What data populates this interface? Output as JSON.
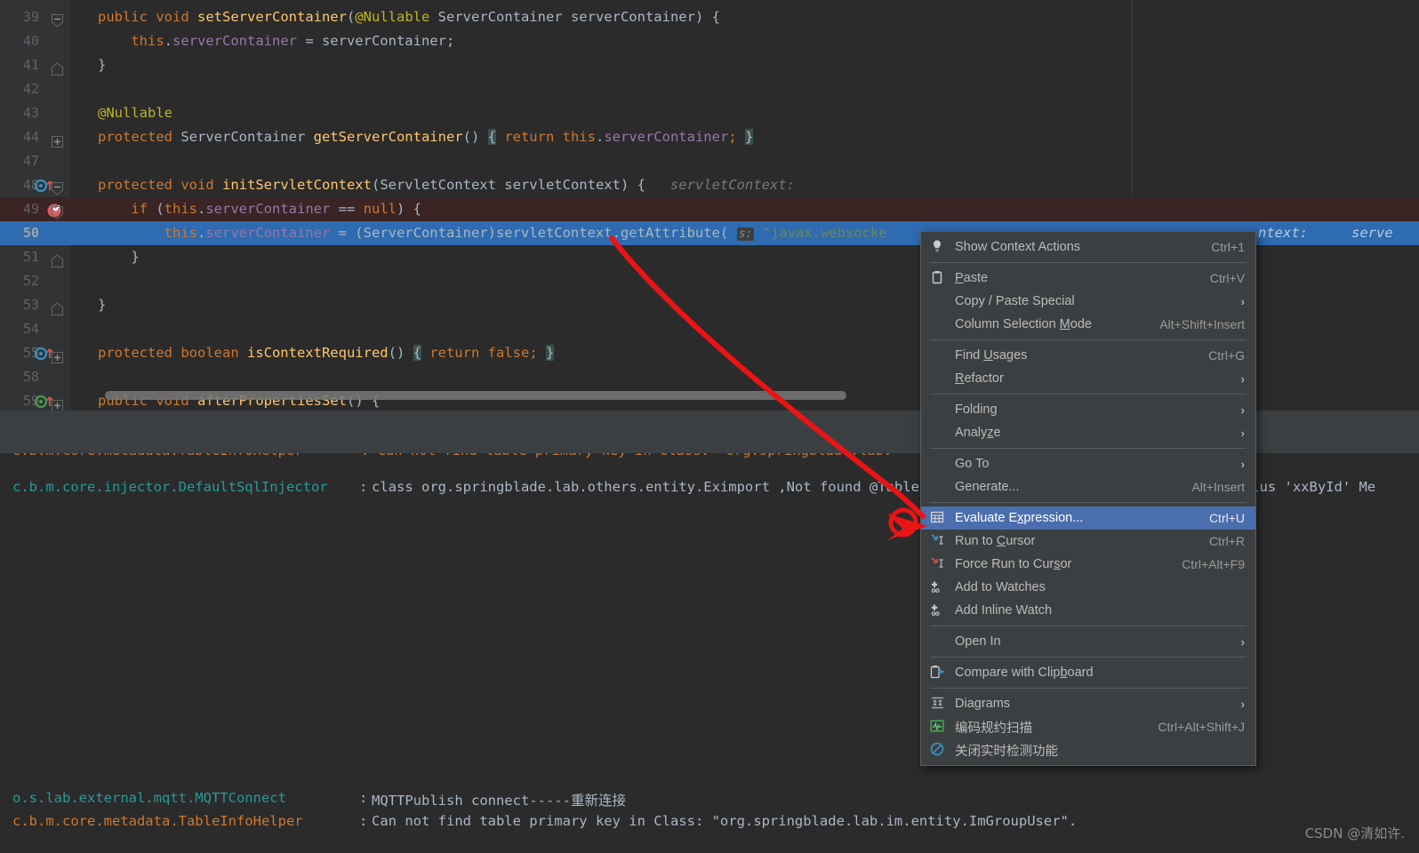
{
  "editor": {
    "lines": [
      {
        "num": "39",
        "indent": 0,
        "state": "normal",
        "fold": "collapse",
        "marker": "",
        "tokens": [
          {
            "t": "public ",
            "c": "kw"
          },
          {
            "t": "void ",
            "c": "kw"
          },
          {
            "t": "setServerContainer",
            "c": "fn"
          },
          {
            "t": "(",
            "c": "pln"
          },
          {
            "t": "@Nullable",
            "c": "ann"
          },
          {
            "t": " ServerContainer serverContainer) {",
            "c": "pln"
          }
        ]
      },
      {
        "num": "40",
        "indent": 0,
        "state": "normal",
        "fold": "",
        "marker": "",
        "tokens": [
          {
            "t": "    ",
            "c": "pln"
          },
          {
            "t": "this",
            "c": "kw"
          },
          {
            "t": ".",
            "c": "pln"
          },
          {
            "t": "serverContainer",
            "c": "fld"
          },
          {
            "t": " = serverContainer;",
            "c": "pln"
          }
        ]
      },
      {
        "num": "41",
        "indent": 0,
        "state": "normal",
        "fold": "end",
        "marker": "",
        "tokens": [
          {
            "t": "}",
            "c": "pln"
          }
        ]
      },
      {
        "num": "42",
        "indent": 0,
        "state": "normal",
        "fold": "",
        "marker": "",
        "tokens": []
      },
      {
        "num": "43",
        "indent": 0,
        "state": "normal",
        "fold": "",
        "marker": "",
        "tokens": [
          {
            "t": "@Nullable",
            "c": "ann"
          }
        ]
      },
      {
        "num": "44",
        "indent": 0,
        "state": "normal",
        "fold": "plus",
        "marker": "",
        "tokens": [
          {
            "t": "protected ",
            "c": "kw"
          },
          {
            "t": "ServerContainer ",
            "c": "pln"
          },
          {
            "t": "getServerContainer",
            "c": "fn"
          },
          {
            "t": "() ",
            "c": "pln"
          },
          {
            "t": "{",
            "c": "brace"
          },
          {
            "t": " ",
            "c": "pln"
          },
          {
            "t": "return ",
            "c": "kw"
          },
          {
            "t": "this",
            "c": "kw"
          },
          {
            "t": ".",
            "c": "pln"
          },
          {
            "t": "serverContainer",
            "c": "fld"
          },
          {
            "t": ";",
            "c": "kw"
          },
          {
            "t": " ",
            "c": "pln"
          },
          {
            "t": "}",
            "c": "brace"
          }
        ]
      },
      {
        "num": "47",
        "indent": 0,
        "state": "normal",
        "fold": "",
        "marker": "",
        "tokens": []
      },
      {
        "num": "48",
        "indent": 0,
        "state": "normal",
        "fold": "collapse",
        "marker": "override",
        "tokens": [
          {
            "t": "protected ",
            "c": "kw"
          },
          {
            "t": "void ",
            "c": "kw"
          },
          {
            "t": "initServletContext",
            "c": "fn"
          },
          {
            "t": "(ServletContext servletContext) {",
            "c": "pln"
          },
          {
            "t": "   servletContext:",
            "c": "hint"
          }
        ]
      },
      {
        "num": "49",
        "indent": 0,
        "state": "error",
        "fold": "collapse",
        "marker": "breakpoint",
        "tokens": [
          {
            "t": "    ",
            "c": "pln"
          },
          {
            "t": "if ",
            "c": "kw"
          },
          {
            "t": "(",
            "c": "pln"
          },
          {
            "t": "this",
            "c": "kw"
          },
          {
            "t": ".",
            "c": "pln"
          },
          {
            "t": "serverContainer",
            "c": "fld"
          },
          {
            "t": " == ",
            "c": "pln"
          },
          {
            "t": "null",
            "c": "kw"
          },
          {
            "t": ") {",
            "c": "pln"
          }
        ]
      },
      {
        "num": "50",
        "indent": 0,
        "state": "selected",
        "fold": "",
        "marker": "",
        "tokens": [
          {
            "t": "        ",
            "c": "pln"
          },
          {
            "t": "this",
            "c": "kw"
          },
          {
            "t": ".",
            "c": "pln"
          },
          {
            "t": "serverContainer",
            "c": "fld"
          },
          {
            "t": " = (ServerContainer)servletContext.getAttribute( ",
            "c": "pln"
          },
          {
            "t": "s:",
            "c": "phint"
          },
          {
            "t": " ",
            "c": "pln"
          },
          {
            "t": "\"javax.websocke",
            "c": "str"
          }
        ]
      },
      {
        "num": "51",
        "indent": 0,
        "state": "normal",
        "fold": "end",
        "marker": "",
        "tokens": [
          {
            "t": "    }",
            "c": "pln"
          }
        ]
      },
      {
        "num": "52",
        "indent": 0,
        "state": "normal",
        "fold": "",
        "marker": "",
        "tokens": []
      },
      {
        "num": "53",
        "indent": 0,
        "state": "normal",
        "fold": "end",
        "marker": "",
        "tokens": [
          {
            "t": "}",
            "c": "pln"
          }
        ]
      },
      {
        "num": "54",
        "indent": 0,
        "state": "normal",
        "fold": "",
        "marker": "",
        "tokens": []
      },
      {
        "num": "55",
        "indent": 0,
        "state": "normal",
        "fold": "plus",
        "marker": "override",
        "tokens": [
          {
            "t": "protected ",
            "c": "kw"
          },
          {
            "t": "boolean ",
            "c": "kw"
          },
          {
            "t": "isContextRequired",
            "c": "fn"
          },
          {
            "t": "() ",
            "c": "pln"
          },
          {
            "t": "{",
            "c": "brace"
          },
          {
            "t": " ",
            "c": "pln"
          },
          {
            "t": "return ",
            "c": "kw"
          },
          {
            "t": "false",
            "c": "kw"
          },
          {
            "t": ";",
            "c": "kw"
          },
          {
            "t": " ",
            "c": "pln"
          },
          {
            "t": "}",
            "c": "brace"
          }
        ]
      },
      {
        "num": "58",
        "indent": 0,
        "state": "normal",
        "fold": "",
        "marker": "",
        "tokens": []
      },
      {
        "num": "59",
        "indent": 0,
        "state": "normal",
        "fold": "plus",
        "marker": "override-green",
        "tokens": [
          {
            "t": "public ",
            "c": "kw"
          },
          {
            "t": "void ",
            "c": "kw"
          },
          {
            "t": "afterPropertiesSet",
            "c": "fn"
          },
          {
            "t": "() {",
            "c": "pln"
          }
        ]
      }
    ],
    "line50_tail_hint": "ntext:",
    "line50_tail_hint2": "serve"
  },
  "console": {
    "partial_top_line": "c.b.m.core.metadata.TableInfoHelper       : Can not find table primary key in Class: \"org.springblade.lab.",
    "lines": [
      {
        "logger": "c.b.m.core.injector.DefaultSqlInjector",
        "sep": ":",
        "message": "class org.springblade.lab.others.entity.Eximport ,Not found @TableId type annotation, Cannot use Mybatis-Plus 'xxById' Me",
        "color": "teal"
      },
      {
        "logger": "o.s.lab.external.mqtt.MQTTConnect",
        "sep": ":",
        "message": "MQTTPublish connect-----重新连接",
        "color": "teal"
      },
      {
        "logger": "c.b.m.core.metadata.TableInfoHelper",
        "sep": ":",
        "message": "Can not find table primary key in Class: \"org.springblade.lab.im.entity.ImGroupUser\".",
        "color": "red"
      }
    ],
    "watermark": "CSDN @清如许."
  },
  "context_menu": {
    "items": [
      {
        "type": "item",
        "icon": "lightbulb-icon",
        "label": "Show Context Actions",
        "mnemonic": "",
        "shortcut": "Ctrl+1",
        "submenu": false,
        "selected": false
      },
      {
        "type": "separator"
      },
      {
        "type": "item",
        "icon": "clipboard-icon",
        "label": "Paste",
        "mnemonic": "P",
        "shortcut": "Ctrl+V",
        "submenu": false,
        "selected": false
      },
      {
        "type": "item",
        "icon": "",
        "label": "Copy / Paste Special",
        "mnemonic": "",
        "shortcut": "",
        "submenu": true,
        "selected": false
      },
      {
        "type": "item",
        "icon": "",
        "label": "Column Selection Mode",
        "mnemonic": "M",
        "shortcut": "Alt+Shift+Insert",
        "submenu": false,
        "selected": false
      },
      {
        "type": "separator"
      },
      {
        "type": "item",
        "icon": "",
        "label": "Find Usages",
        "mnemonic": "U",
        "shortcut": "Ctrl+G",
        "submenu": false,
        "selected": false
      },
      {
        "type": "item",
        "icon": "",
        "label": "Refactor",
        "mnemonic": "R",
        "shortcut": "",
        "submenu": true,
        "selected": false
      },
      {
        "type": "separator"
      },
      {
        "type": "item",
        "icon": "",
        "label": "Folding",
        "mnemonic": "",
        "shortcut": "",
        "submenu": true,
        "selected": false
      },
      {
        "type": "item",
        "icon": "",
        "label": "Analyze",
        "mnemonic": "z",
        "shortcut": "",
        "submenu": true,
        "selected": false
      },
      {
        "type": "separator"
      },
      {
        "type": "item",
        "icon": "",
        "label": "Go To",
        "mnemonic": "",
        "shortcut": "",
        "submenu": true,
        "selected": false
      },
      {
        "type": "item",
        "icon": "",
        "label": "Generate...",
        "mnemonic": "",
        "shortcut": "Alt+Insert",
        "submenu": false,
        "selected": false
      },
      {
        "type": "separator"
      },
      {
        "type": "item",
        "icon": "evaluate-expression-icon",
        "label": "Evaluate Expression...",
        "mnemonic": "x",
        "shortcut": "Ctrl+U",
        "submenu": false,
        "selected": true
      },
      {
        "type": "item",
        "icon": "run-to-cursor-icon",
        "label": "Run to Cursor",
        "mnemonic": "C",
        "shortcut": "Ctrl+R",
        "submenu": false,
        "selected": false
      },
      {
        "type": "item",
        "icon": "force-run-to-cursor-icon",
        "label": "Force Run to Cursor",
        "mnemonic": "s",
        "shortcut": "Ctrl+Alt+F9",
        "submenu": false,
        "selected": false
      },
      {
        "type": "item",
        "icon": "add-watch-icon",
        "label": "Add to Watches",
        "mnemonic": "",
        "shortcut": "",
        "submenu": false,
        "selected": false
      },
      {
        "type": "item",
        "icon": "add-watch-icon",
        "label": "Add Inline Watch",
        "mnemonic": "",
        "shortcut": "",
        "submenu": false,
        "selected": false
      },
      {
        "type": "separator"
      },
      {
        "type": "item",
        "icon": "",
        "label": "Open In",
        "mnemonic": "",
        "shortcut": "",
        "submenu": true,
        "selected": false
      },
      {
        "type": "separator"
      },
      {
        "type": "item",
        "icon": "compare-clipboard-icon",
        "label": "Compare with Clipboard",
        "mnemonic": "b",
        "shortcut": "",
        "submenu": false,
        "selected": false
      },
      {
        "type": "separator"
      },
      {
        "type": "item",
        "icon": "diagrams-icon",
        "label": "Diagrams",
        "mnemonic": "",
        "shortcut": "",
        "submenu": true,
        "selected": false
      },
      {
        "type": "item",
        "icon": "code-scan-icon",
        "label": "编码规约扫描",
        "mnemonic": "",
        "shortcut": "Ctrl+Alt+Shift+J",
        "submenu": false,
        "selected": false
      },
      {
        "type": "item",
        "icon": "disable-realtime-icon",
        "label": "关闭实时检测功能",
        "mnemonic": "",
        "shortcut": "",
        "submenu": false,
        "selected": false
      }
    ]
  },
  "colors": {
    "editor_bg": "#2b2b2b",
    "gutter_bg": "#313335",
    "selection_blue": "#2f6bb0",
    "error_line": "#3a2424",
    "menu_bg": "#3c3f41",
    "menu_selected": "#4b6eaf",
    "annotation_red": "#e81416",
    "logger_teal": "#299999",
    "logger_red": "#cc7832"
  }
}
